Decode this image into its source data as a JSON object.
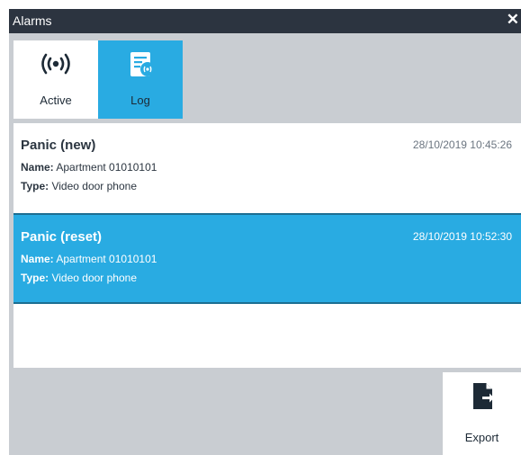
{
  "window": {
    "title": "Alarms",
    "close_icon": "close-icon"
  },
  "tabs": [
    {
      "label": "Active",
      "icon": "alarm-signal-icon",
      "selected": false
    },
    {
      "label": "Log",
      "icon": "log-list-icon",
      "selected": true
    }
  ],
  "alarms": [
    {
      "title": "Panic (new)",
      "datetime": "28/10/2019 10:45:26",
      "name_label": "Name:",
      "name_value": "Apartment 01010101",
      "type_label": "Type:",
      "type_value": "Video door phone",
      "selected": false
    },
    {
      "title": "Panic (reset)",
      "datetime": "28/10/2019 10:52:30",
      "name_label": "Name:",
      "name_value": "Apartment 01010101",
      "type_label": "Type:",
      "type_value": "Video door phone",
      "selected": true
    }
  ],
  "footer": {
    "export_label": "Export",
    "export_icon": "export-file-icon"
  },
  "colors": {
    "accent": "#29abe2",
    "titlebar": "#2c3440",
    "background": "#c9cdd2"
  }
}
